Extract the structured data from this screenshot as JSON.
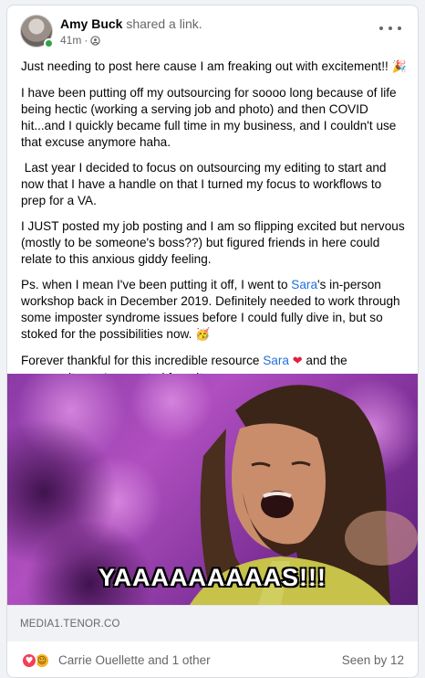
{
  "post": {
    "author": "Amy Buck",
    "action": "shared a link.",
    "time": "41m",
    "separator": "·",
    "privacy_icon": "globe-icon",
    "more_icon": "more-options-icon",
    "paragraphs": {
      "p1": "Just needing to post here cause I am freaking out with excitement!!",
      "p1_emoji": "🎉",
      "p2": "I have been putting off my outsourcing for soooo long because of life being hectic (working a serving job and photo) and then COVID hit...and I quickly became full time in my business, and I couldn't use that excuse anymore haha.",
      "p3": " Last year I decided to focus on outsourcing my editing to start and now that I have a handle on that I turned my focus to workflows to prep for a VA.",
      "p4": "I JUST posted my job posting and I am so flipping excited but nervous (mostly to be someone's boss??) but figured friends in here could relate to this anxious giddy feeling.",
      "p5_before": "Ps. when I mean I've been putting it off, I went to ",
      "p5_mention": "Sara",
      "p5_after": "'s in-person workshop back in December 2019. Definitely needed to work through some imposter syndrome issues before I could fully dive in, but so stoked for the possibilities now.",
      "p5_emoji": "🥳",
      "p6_before": "Forever thankful for this incredible resource ",
      "p6_mention": "Sara",
      "p6_emoji": "❤",
      "p6_after": " and the community you've created from it."
    }
  },
  "media": {
    "caption": "YAAAAAAAAAS!!!",
    "domain": "MEDIA1.TENOR.CO"
  },
  "footer": {
    "reaction_icons": [
      "love-reaction-icon",
      "care-reaction-icon"
    ],
    "reaction_glyphs": [
      "♥",
      "☺"
    ],
    "reactors": "Carrie Ouellette and 1 other",
    "seen_by": "Seen by 12"
  },
  "colors": {
    "link": "#216fdb",
    "secondary_text": "#65676b",
    "online": "#31a24c",
    "love": "#f33e58"
  }
}
